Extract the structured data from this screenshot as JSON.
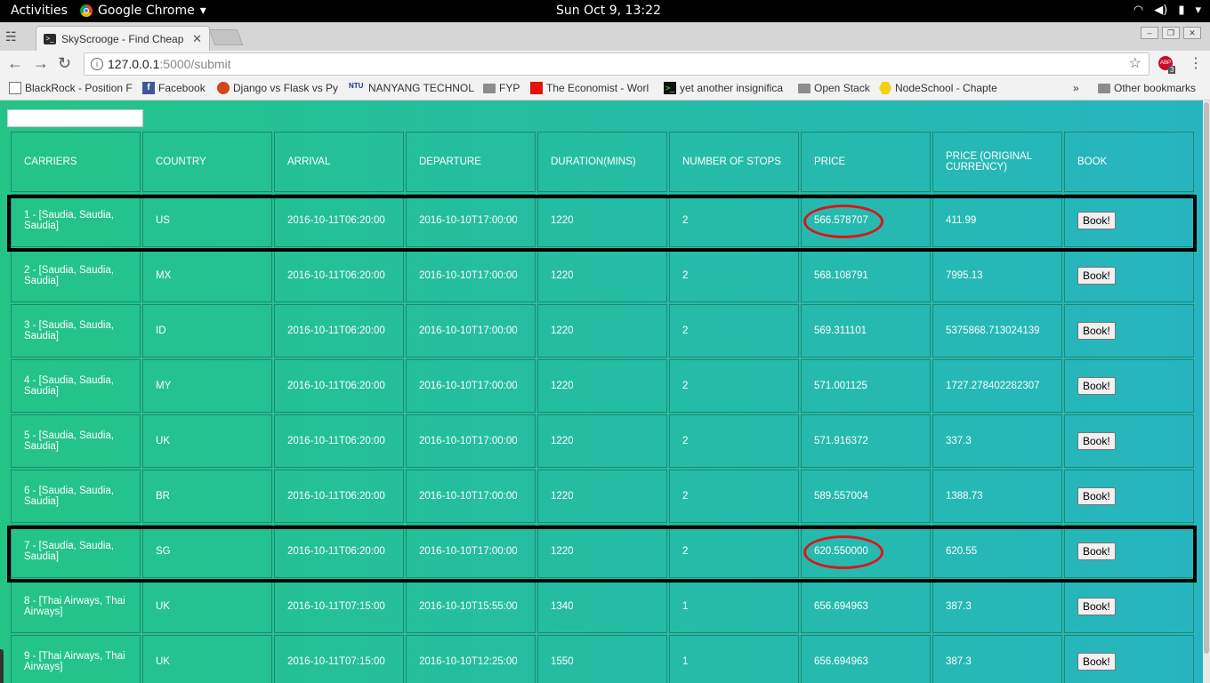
{
  "system_bar": {
    "activities": "Activities",
    "app_name": "Google Chrome",
    "clock": "Sun Oct  9, 13:22"
  },
  "browser": {
    "tab_title": "SkyScrooge - Find Cheap",
    "url_host": "127.0.0.1",
    "url_path": ":5000/submit",
    "adblock_count": "3",
    "bookmarks": [
      {
        "label": "BlackRock - Position F",
        "icon": "doc-icon"
      },
      {
        "label": "Facebook",
        "icon": "facebook-icon"
      },
      {
        "label": "Django vs Flask vs Py",
        "icon": "django-icon"
      },
      {
        "label": "NANYANG TECHNOL",
        "icon": "ntu-icon"
      },
      {
        "label": "FYP",
        "icon": "folder-icon"
      },
      {
        "label": "The Economist - Worl",
        "icon": "economist-icon"
      },
      {
        "label": "yet another insignifica",
        "icon": "terminal-icon"
      },
      {
        "label": "Open Stack",
        "icon": "folder-icon"
      },
      {
        "label": "NodeSchool - Chapte",
        "icon": "nodeschool-icon"
      }
    ],
    "other_bookmarks": "Other bookmarks"
  },
  "table": {
    "headers": [
      "CARRIERS",
      "COUNTRY",
      "ARRIVAL",
      "DEPARTURE",
      "DURATION(MINS)",
      "NUMBER OF STOPS",
      "PRICE",
      "PRICE (ORIGINAL CURRENCY)",
      "BOOK"
    ],
    "book_label": "Book!",
    "rows": [
      {
        "carriers": "1 - [Saudia, Saudia, Saudia]",
        "country": "US",
        "arrival": "2016-10-11T06:20:00",
        "departure": "2016-10-10T17:00:00",
        "duration": "1220",
        "stops": "2",
        "price": "566.578707",
        "price_original": "411.99"
      },
      {
        "carriers": "2 - [Saudia, Saudia, Saudia]",
        "country": "MX",
        "arrival": "2016-10-11T06:20:00",
        "departure": "2016-10-10T17:00:00",
        "duration": "1220",
        "stops": "2",
        "price": "568.108791",
        "price_original": "7995.13"
      },
      {
        "carriers": "3 - [Saudia, Saudia, Saudia]",
        "country": "ID",
        "arrival": "2016-10-11T06:20:00",
        "departure": "2016-10-10T17:00:00",
        "duration": "1220",
        "stops": "2",
        "price": "569.311101",
        "price_original": "5375868.713024139"
      },
      {
        "carriers": "4 - [Saudia, Saudia, Saudia]",
        "country": "MY",
        "arrival": "2016-10-11T06:20:00",
        "departure": "2016-10-10T17:00:00",
        "duration": "1220",
        "stops": "2",
        "price": "571.001125",
        "price_original": "1727.278402282307"
      },
      {
        "carriers": "5 - [Saudia, Saudia, Saudia]",
        "country": "UK",
        "arrival": "2016-10-11T06:20:00",
        "departure": "2016-10-10T17:00:00",
        "duration": "1220",
        "stops": "2",
        "price": "571.916372",
        "price_original": "337.3"
      },
      {
        "carriers": "6 - [Saudia, Saudia, Saudia]",
        "country": "BR",
        "arrival": "2016-10-11T06:20:00",
        "departure": "2016-10-10T17:00:00",
        "duration": "1220",
        "stops": "2",
        "price": "589.557004",
        "price_original": "1388.73"
      },
      {
        "carriers": "7 - [Saudia, Saudia, Saudia]",
        "country": "SG",
        "arrival": "2016-10-11T06:20:00",
        "departure": "2016-10-10T17:00:00",
        "duration": "1220",
        "stops": "2",
        "price": "620.550000",
        "price_original": "620.55"
      },
      {
        "carriers": "8 - [Thai Airways, Thai Airways]",
        "country": "UK",
        "arrival": "2016-10-11T07:15:00",
        "departure": "2016-10-10T15:55:00",
        "duration": "1340",
        "stops": "1",
        "price": "656.694963",
        "price_original": "387.3"
      },
      {
        "carriers": "9 - [Thai Airways, Thai Airways]",
        "country": "UK",
        "arrival": "2016-10-11T07:15:00",
        "departure": "2016-10-10T12:25:00",
        "duration": "1550",
        "stops": "1",
        "price": "656.694963",
        "price_original": "387.3"
      }
    ]
  },
  "colors": {
    "gradient_start": "#24c487",
    "gradient_end": "#26b5c0",
    "highlight_ring": "#d9161c",
    "highlight_box": "#000000"
  }
}
